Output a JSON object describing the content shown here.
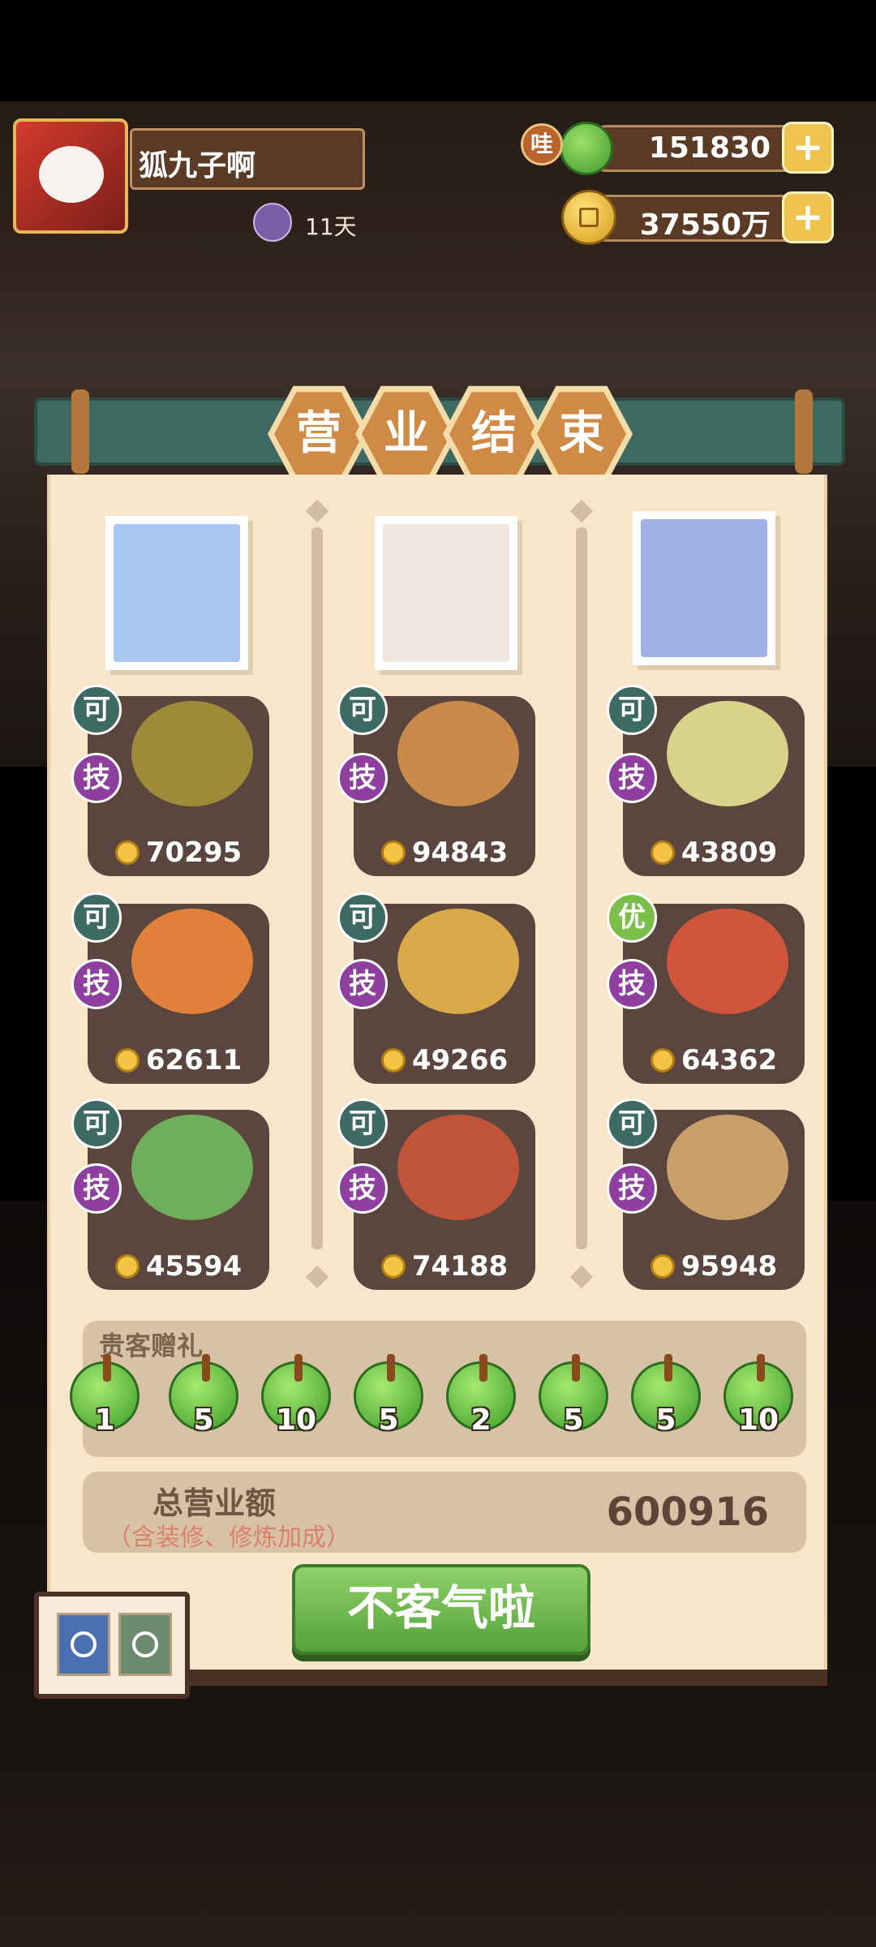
{
  "header": {
    "player_name": "狐九子啊",
    "days": "11天",
    "wa_label": "哇",
    "jade_amount": "151830",
    "coin_amount": "37550万",
    "plus_label": "+"
  },
  "title": [
    "营",
    "业",
    "结",
    "束"
  ],
  "columns": [
    {
      "portrait": "portrait-white-hair-boy",
      "portrait_color": "#a9c6f2",
      "dishes": [
        {
          "badge1": "可",
          "badge1_type": "ke",
          "badge2": "技",
          "price": "70295",
          "color": "#9f8a3a"
        },
        {
          "badge1": "可",
          "badge1_type": "ke",
          "badge2": "技",
          "price": "62611",
          "color": "#e0803a"
        },
        {
          "badge1": "可",
          "badge1_type": "ke",
          "badge2": "技",
          "price": "45594",
          "color": "#6fae5a"
        }
      ]
    },
    {
      "portrait": "portrait-cat-ear-girl",
      "portrait_color": "#f0e6de",
      "dishes": [
        {
          "badge1": "可",
          "badge1_type": "ke",
          "badge2": "技",
          "price": "94843",
          "color": "#c98a4a"
        },
        {
          "badge1": "可",
          "badge1_type": "ke",
          "badge2": "技",
          "price": "49266",
          "color": "#d9a94a"
        },
        {
          "badge1": "可",
          "badge1_type": "ke",
          "badge2": "技",
          "price": "74188",
          "color": "#c0553a"
        }
      ]
    },
    {
      "portrait": "portrait-blue-hair-girl",
      "portrait_color": "#9fb0e6",
      "dishes": [
        {
          "badge1": "可",
          "badge1_type": "ke",
          "badge2": "技",
          "price": "43809",
          "color": "#d9d28a"
        },
        {
          "badge1": "优",
          "badge1_type": "you",
          "badge2": "技",
          "price": "64362",
          "color": "#d0553a"
        },
        {
          "badge1": "可",
          "badge1_type": "ke",
          "badge2": "技",
          "price": "95948",
          "color": "#c9a06a"
        }
      ]
    }
  ],
  "gifts": {
    "label": "贵客赠礼",
    "items": [
      "1",
      "5",
      "10",
      "5",
      "2",
      "5",
      "5",
      "10"
    ]
  },
  "total": {
    "label": "总营业额",
    "note": "（含装修、修炼加成）",
    "value": "600916"
  },
  "confirm_button": "不客气啦"
}
